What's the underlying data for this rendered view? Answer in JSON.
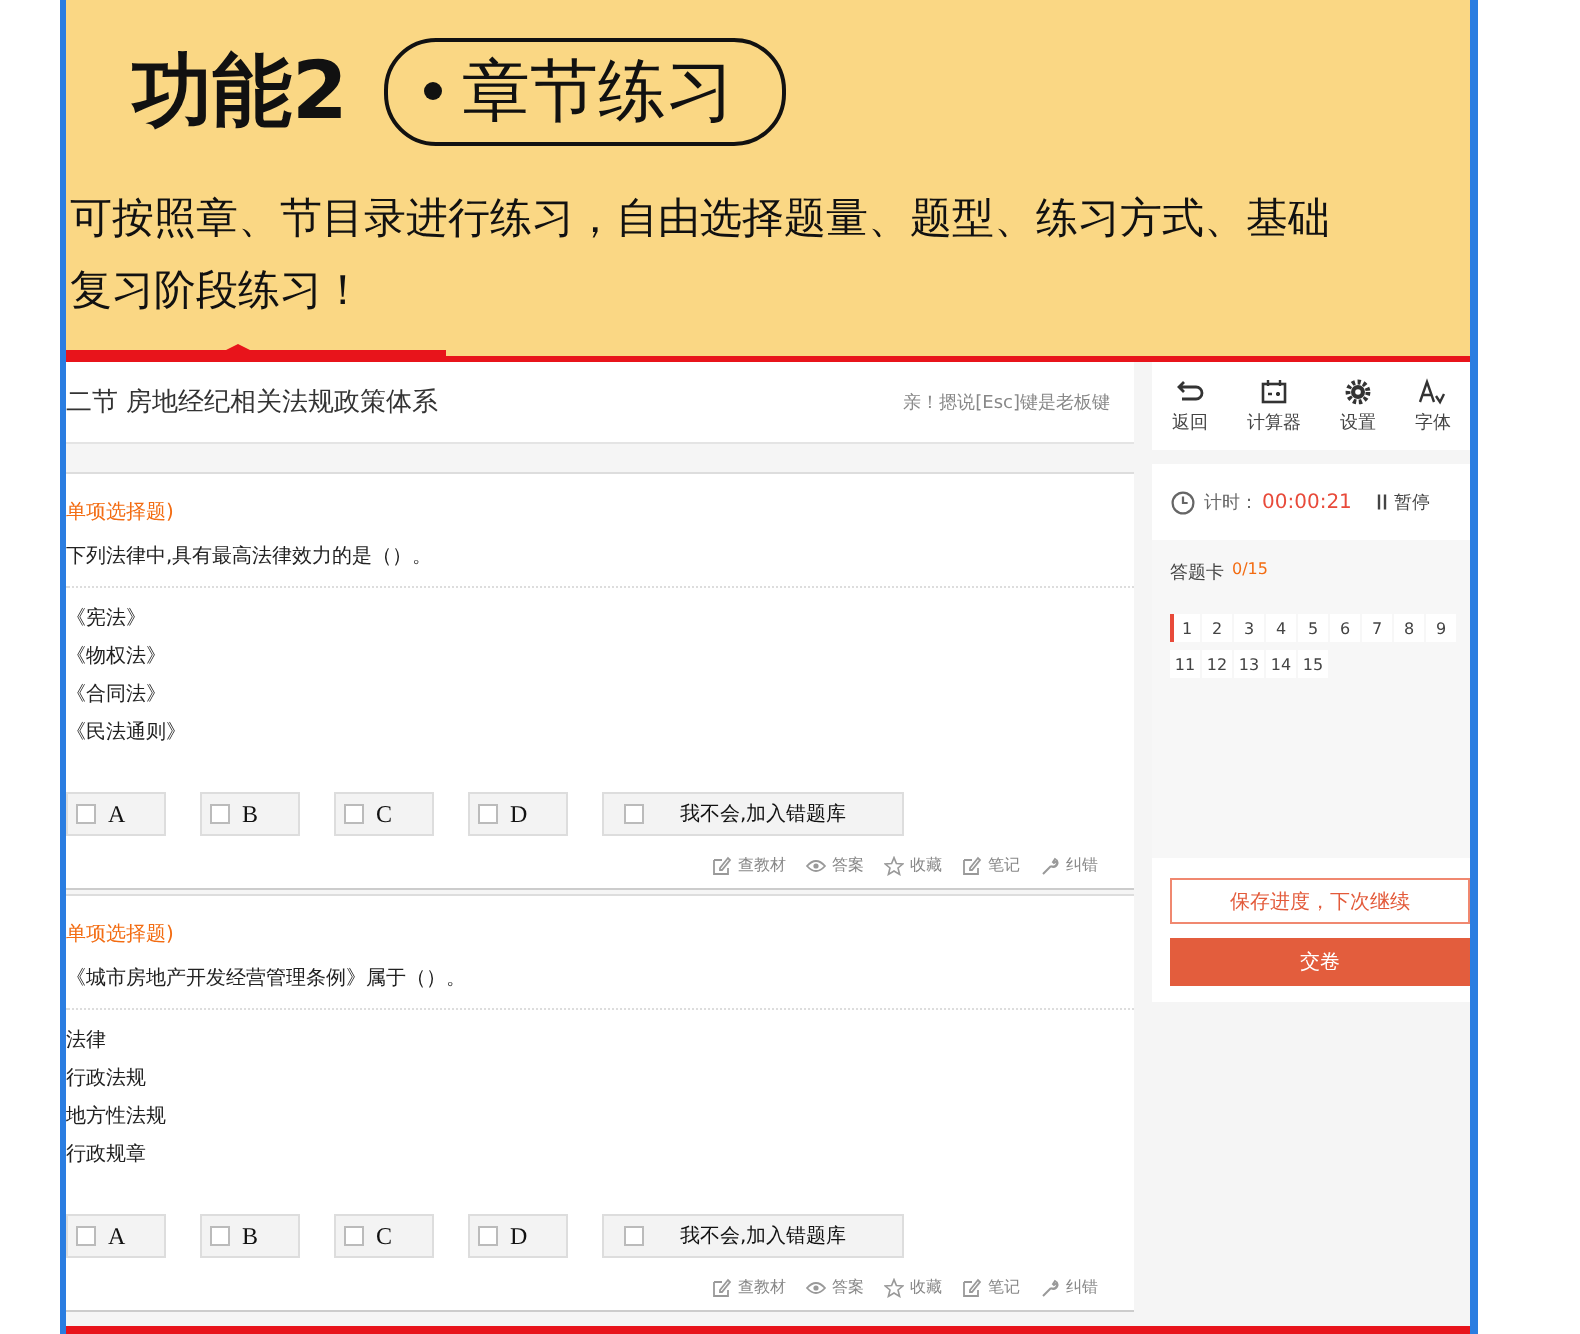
{
  "banner": {
    "title": "功能2",
    "badge": "章节练习",
    "description": "可按照章、节目录进行练习，自由选择题量、题型、练习方式、基础复习阶段练习！"
  },
  "header": {
    "title": "二节 房地经纪相关法规政策体系",
    "hint": "亲！摁说[Esc]键是老板键"
  },
  "questions": [
    {
      "type": "单项选择题)",
      "text": "下列法律中,具有最高法律效力的是（）。",
      "options": [
        "《宪法》",
        "《物权法》",
        "《合同法》",
        "《民法通则》"
      ],
      "choices": [
        {
          "label": "A",
          "checked": false
        },
        {
          "label": "B",
          "checked": false
        },
        {
          "label": "C",
          "checked": false
        },
        {
          "label": "D",
          "checked": false
        }
      ],
      "unknown": {
        "label": "我不会,加入错题库",
        "checked": false
      },
      "tools": [
        {
          "kind": "book",
          "label": "查教材"
        },
        {
          "kind": "eye",
          "label": "答案"
        },
        {
          "kind": "star",
          "label": "收藏"
        },
        {
          "kind": "note",
          "label": "笔记"
        },
        {
          "kind": "wrench",
          "label": "纠错"
        }
      ]
    },
    {
      "type": "单项选择题)",
      "text": "《城市房地产开发经营管理条例》属于（）。",
      "options": [
        "法律",
        "行政法规",
        "地方性法规",
        "行政规章"
      ],
      "choices": [
        {
          "label": "A",
          "checked": false
        },
        {
          "label": "B",
          "checked": false
        },
        {
          "label": "C",
          "checked": false
        },
        {
          "label": "D",
          "checked": false
        }
      ],
      "unknown": {
        "label": "我不会,加入错题库",
        "checked": false
      },
      "tools": [
        {
          "kind": "book",
          "label": "查教材"
        },
        {
          "kind": "eye",
          "label": "答案"
        },
        {
          "kind": "star",
          "label": "收藏"
        },
        {
          "kind": "note",
          "label": "笔记"
        },
        {
          "kind": "wrench",
          "label": "纠错"
        }
      ]
    }
  ],
  "toolbar": [
    {
      "kind": "back",
      "label": "返回"
    },
    {
      "kind": "calculator",
      "label": "计算器"
    },
    {
      "kind": "settings",
      "label": "设置"
    },
    {
      "kind": "font",
      "label": "字体"
    }
  ],
  "timer": {
    "label": "计时：",
    "time": "00:00:21",
    "pause": "暂停"
  },
  "answer_card": {
    "title": "答题卡",
    "progress": "0/15",
    "cells": [
      {
        "label": "1",
        "current": true
      },
      {
        "label": "2",
        "current": false
      },
      {
        "label": "3",
        "current": false
      },
      {
        "label": "4",
        "current": false
      },
      {
        "label": "5",
        "current": false
      },
      {
        "label": "6",
        "current": false
      },
      {
        "label": "7",
        "current": false
      },
      {
        "label": "8",
        "current": false
      },
      {
        "label": "9",
        "current": false
      },
      {
        "label": "11",
        "current": false
      },
      {
        "label": "12",
        "current": false
      },
      {
        "label": "13",
        "current": false
      },
      {
        "label": "14",
        "current": false
      },
      {
        "label": "15",
        "current": false
      }
    ]
  },
  "save_button": "保存进度，下次继续",
  "submit_button": "交卷"
}
